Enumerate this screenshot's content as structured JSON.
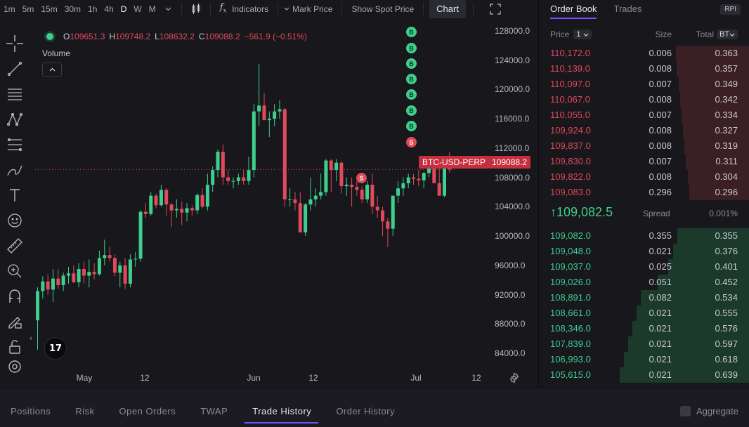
{
  "toolbar": {
    "timeframes": [
      "1m",
      "5m",
      "15m",
      "30m",
      "1h",
      "4h",
      "D",
      "W",
      "M"
    ],
    "active_timeframe": "D",
    "indicators_label": "Indicators",
    "mark_price_label": "Mark Price",
    "spot_price_label": "Show Spot Price",
    "chart_label": "Chart"
  },
  "ohlc": {
    "o_label": "O",
    "o": "109651.3",
    "h_label": "H",
    "h": "109748.2",
    "l_label": "L",
    "l": "108632.2",
    "c_label": "C",
    "c": "109088.2",
    "change": "−561.9 (−0.51%)"
  },
  "volume_label": "Volume",
  "tv_logo": "17",
  "price_tag": "109088.2",
  "symbol_tag": "BTC-USD-PERP",
  "colors": {
    "up": "#3ecf8e",
    "down": "#e04a5c",
    "accent": "#7c4dff"
  },
  "chart_data": {
    "type": "candlestick",
    "y_ticks": [
      "128000.0",
      "124000.0",
      "120000.0",
      "116000.0",
      "112000.0",
      "108000.0",
      "104000.0",
      "100000.0",
      "96000.0",
      "92000.0",
      "88000.0",
      "84000.0"
    ],
    "x_labels": [
      "May",
      "12",
      "Jun",
      "12",
      "Jul",
      "12"
    ],
    "ylim": [
      82000,
      129700
    ],
    "current_price": 109088.2,
    "markers": [
      "B",
      "B",
      "B",
      "B",
      "B",
      "B",
      "B",
      "S",
      "S"
    ],
    "candles": [
      [
        88500,
        93000,
        84500,
        92500
      ],
      [
        92500,
        94500,
        91500,
        93800
      ],
      [
        93800,
        94800,
        92000,
        92700
      ],
      [
        92700,
        95500,
        91000,
        94200
      ],
      [
        94200,
        95500,
        92800,
        93300
      ],
      [
        93300,
        95000,
        92500,
        94600
      ],
      [
        94600,
        95800,
        93500,
        94900
      ],
      [
        94900,
        96000,
        93600,
        93700
      ],
      [
        93700,
        96300,
        93000,
        95500
      ],
      [
        95500,
        96500,
        93500,
        94600
      ],
      [
        94600,
        96800,
        93000,
        95100
      ],
      [
        95100,
        96300,
        94100,
        94800
      ],
      [
        94800,
        98000,
        94600,
        97000
      ],
      [
        97000,
        99500,
        96000,
        97400
      ],
      [
        97400,
        98500,
        96500,
        97000
      ],
      [
        97000,
        97500,
        94500,
        95000
      ],
      [
        95000,
        96500,
        93000,
        96000
      ],
      [
        96000,
        97000,
        92800,
        93500
      ],
      [
        93500,
        97500,
        93000,
        96800
      ],
      [
        96800,
        97800,
        95800,
        96900
      ],
      [
        96900,
        103500,
        96500,
        103300
      ],
      [
        103300,
        104500,
        102500,
        103000
      ],
      [
        103000,
        106000,
        102800,
        105500
      ],
      [
        105500,
        105800,
        103800,
        104200
      ],
      [
        104200,
        107000,
        104000,
        106300
      ],
      [
        106300,
        106500,
        102800,
        104300
      ],
      [
        104300,
        104500,
        101200,
        103500
      ],
      [
        103500,
        105000,
        102500,
        103700
      ],
      [
        103700,
        104700,
        101500,
        103200
      ],
      [
        103200,
        104500,
        102000,
        103800
      ],
      [
        103800,
        104200,
        102800,
        103500
      ],
      [
        103500,
        105800,
        103000,
        105600
      ],
      [
        105600,
        106500,
        103800,
        104000
      ],
      [
        104000,
        108500,
        103500,
        107000
      ],
      [
        107000,
        109500,
        106000,
        109000
      ],
      [
        109000,
        111800,
        108000,
        111500
      ],
      [
        111500,
        112500,
        107000,
        108000
      ],
      [
        108000,
        109000,
        107000,
        107500
      ],
      [
        107500,
        108000,
        106500,
        107500
      ],
      [
        107500,
        108500,
        107000,
        108000
      ],
      [
        108000,
        109000,
        107000,
        107500
      ],
      [
        107500,
        110800,
        107000,
        109000
      ],
      [
        109000,
        118000,
        108000,
        117000
      ],
      [
        117000,
        123500,
        115000,
        117800
      ],
      [
        117800,
        119500,
        116500,
        115800
      ],
      [
        115800,
        117000,
        113500,
        116000
      ],
      [
        116000,
        118000,
        115000,
        117000
      ],
      [
        117000,
        118500,
        116000,
        117300
      ],
      [
        117300,
        117500,
        104000,
        105000
      ],
      [
        105000,
        106500,
        104000,
        105000
      ],
      [
        105000,
        106000,
        103500,
        104500
      ],
      [
        104500,
        106000,
        100500,
        100500
      ],
      [
        100500,
        104500,
        100000,
        104300
      ],
      [
        104300,
        108000,
        103500,
        105000
      ],
      [
        105000,
        106500,
        104000,
        105500
      ],
      [
        105500,
        108500,
        105000,
        106000
      ],
      [
        106000,
        110500,
        105500,
        110300
      ],
      [
        110300,
        110500,
        106000,
        109000
      ],
      [
        109000,
        110500,
        107500,
        110000
      ],
      [
        110000,
        110200,
        105800,
        106800
      ],
      [
        106800,
        108000,
        105500,
        107000
      ],
      [
        107000,
        108000,
        104000,
        106700
      ],
      [
        106700,
        107500,
        105500,
        106300
      ],
      [
        106300,
        106800,
        104500,
        105000
      ],
      [
        105000,
        107500,
        104500,
        107000
      ],
      [
        107000,
        108500,
        103000,
        104000
      ],
      [
        104000,
        105500,
        102500,
        103500
      ],
      [
        103500,
        104000,
        100000,
        102000
      ],
      [
        102000,
        102500,
        98500,
        101000
      ],
      [
        101000,
        105500,
        100000,
        105500
      ],
      [
        105500,
        107500,
        104500,
        106500
      ],
      [
        106500,
        108000,
        105500,
        107200
      ],
      [
        107200,
        108500,
        106500,
        108000
      ],
      [
        108000,
        108500,
        107000,
        107800
      ],
      [
        107800,
        109000,
        106800,
        107600
      ],
      [
        107600,
        108700,
        106500,
        108600
      ],
      [
        108600,
        110500,
        108000,
        109500
      ],
      [
        109500,
        110000,
        107500,
        107200
      ],
      [
        107200,
        110200,
        105500,
        105500
      ],
      [
        105500,
        110000,
        105300,
        109651.3
      ],
      [
        109651.3,
        111500,
        108632.2,
        109088.2
      ]
    ]
  },
  "orderbook": {
    "tabs": [
      "Order Book",
      "Trades"
    ],
    "rpi": "RPI",
    "price_header": "Price",
    "price_step": "1",
    "size_header": "Size",
    "total_header": "Total",
    "total_unit": "BTC",
    "asks": [
      {
        "price": "110,172.0",
        "size": "0.006",
        "total": "0.363",
        "depth": 0.363
      },
      {
        "price": "110,139.0",
        "size": "0.008",
        "total": "0.357",
        "depth": 0.357
      },
      {
        "price": "110,097.0",
        "size": "0.007",
        "total": "0.349",
        "depth": 0.349
      },
      {
        "price": "110,067.0",
        "size": "0.008",
        "total": "0.342",
        "depth": 0.342
      },
      {
        "price": "110,055.0",
        "size": "0.007",
        "total": "0.334",
        "depth": 0.334
      },
      {
        "price": "109,924.0",
        "size": "0.008",
        "total": "0.327",
        "depth": 0.327
      },
      {
        "price": "109,837.0",
        "size": "0.008",
        "total": "0.319",
        "depth": 0.319
      },
      {
        "price": "109,830.0",
        "size": "0.007",
        "total": "0.311",
        "depth": 0.311
      },
      {
        "price": "109,822.0",
        "size": "0.008",
        "total": "0.304",
        "depth": 0.304
      },
      {
        "price": "109,083.0",
        "size": "0.296",
        "total": "0.296",
        "depth": 0.296
      }
    ],
    "mid_price": "109,082.5",
    "mid_arrow": "↑",
    "spread_label": "Spread",
    "spread_value": "0.001%",
    "bids": [
      {
        "price": "109,082.0",
        "size": "0.355",
        "total": "0.355",
        "depth": 0.355
      },
      {
        "price": "109,048.0",
        "size": "0.021",
        "total": "0.376",
        "depth": 0.376
      },
      {
        "price": "109,037.0",
        "size": "0.025",
        "total": "0.401",
        "depth": 0.401
      },
      {
        "price": "109,026.0",
        "size": "0.051",
        "total": "0.452",
        "depth": 0.452
      },
      {
        "price": "108,891.0",
        "size": "0.082",
        "total": "0.534",
        "depth": 0.534
      },
      {
        "price": "108,661.0",
        "size": "0.021",
        "total": "0.555",
        "depth": 0.555
      },
      {
        "price": "108,346.0",
        "size": "0.021",
        "total": "0.576",
        "depth": 0.576
      },
      {
        "price": "107,839.0",
        "size": "0.021",
        "total": "0.597",
        "depth": 0.597
      },
      {
        "price": "106,993.0",
        "size": "0.021",
        "total": "0.618",
        "depth": 0.618
      },
      {
        "price": "105,615.0",
        "size": "0.021",
        "total": "0.639",
        "depth": 0.639
      }
    ]
  },
  "bottom_tabs": [
    "Positions",
    "Risk",
    "Open Orders",
    "TWAP",
    "Trade History",
    "Order History"
  ],
  "active_bottom_tab": "Trade History",
  "aggregate_label": "Aggregate"
}
